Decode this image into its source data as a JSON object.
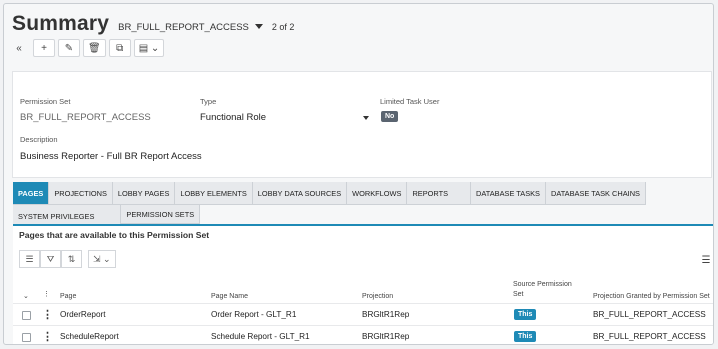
{
  "header": {
    "title": "Summary",
    "record": "BR_FULL_REPORT_ACCESS",
    "navigation": "2 of 2"
  },
  "toolbar": {
    "collapse_glyph": "«",
    "add_glyph": "+",
    "edit_glyph": "✎",
    "delete_glyph": "🗑",
    "copy_glyph": "⧉",
    "more_glyph": "▤ ⌄"
  },
  "form": {
    "permission_set_label": "Permission Set",
    "permission_set_value": "BR_FULL_REPORT_ACCESS",
    "type_label": "Type",
    "type_value": "Functional Role",
    "limited_task_user_label": "Limited Task User",
    "limited_task_user_value": "No",
    "description_label": "Description",
    "description_value": "Business Reporter - Full BR Report Access"
  },
  "tabs": [
    {
      "label": "PAGES"
    },
    {
      "label": "PROJECTIONS"
    },
    {
      "label": "LOBBY PAGES"
    },
    {
      "label": "LOBBY ELEMENTS"
    },
    {
      "label": "LOBBY DATA SOURCES"
    },
    {
      "label": "WORKFLOWS"
    },
    {
      "label": "REPORTS"
    },
    {
      "label": "DATABASE TASKS"
    },
    {
      "label": "DATABASE TASK CHAINS"
    },
    {
      "label": "SYSTEM PRIVILEGES"
    },
    {
      "label": "PERMISSION SETS"
    }
  ],
  "panel": {
    "title": "Pages that are available to this Permission Set",
    "columns": {
      "page": "Page",
      "page_name": "Page Name",
      "projection": "Projection",
      "source_permission_set": "Source Permission Set",
      "projection_granted": "Projection Granted by Permission Set"
    },
    "rows": [
      {
        "page": "OrderReport",
        "page_name": "Order Report - GLT_R1",
        "projection": "BRGltR1Rep",
        "source": "This",
        "granted": "BR_FULL_REPORT_ACCESS"
      },
      {
        "page": "ScheduleReport",
        "page_name": "Schedule Report - GLT_R1",
        "projection": "BRGltR1Rep",
        "source": "This",
        "granted": "BR_FULL_REPORT_ACCESS"
      }
    ]
  },
  "colors": {
    "accent": "#1e8ab6",
    "badge_no": "#5a6470"
  }
}
